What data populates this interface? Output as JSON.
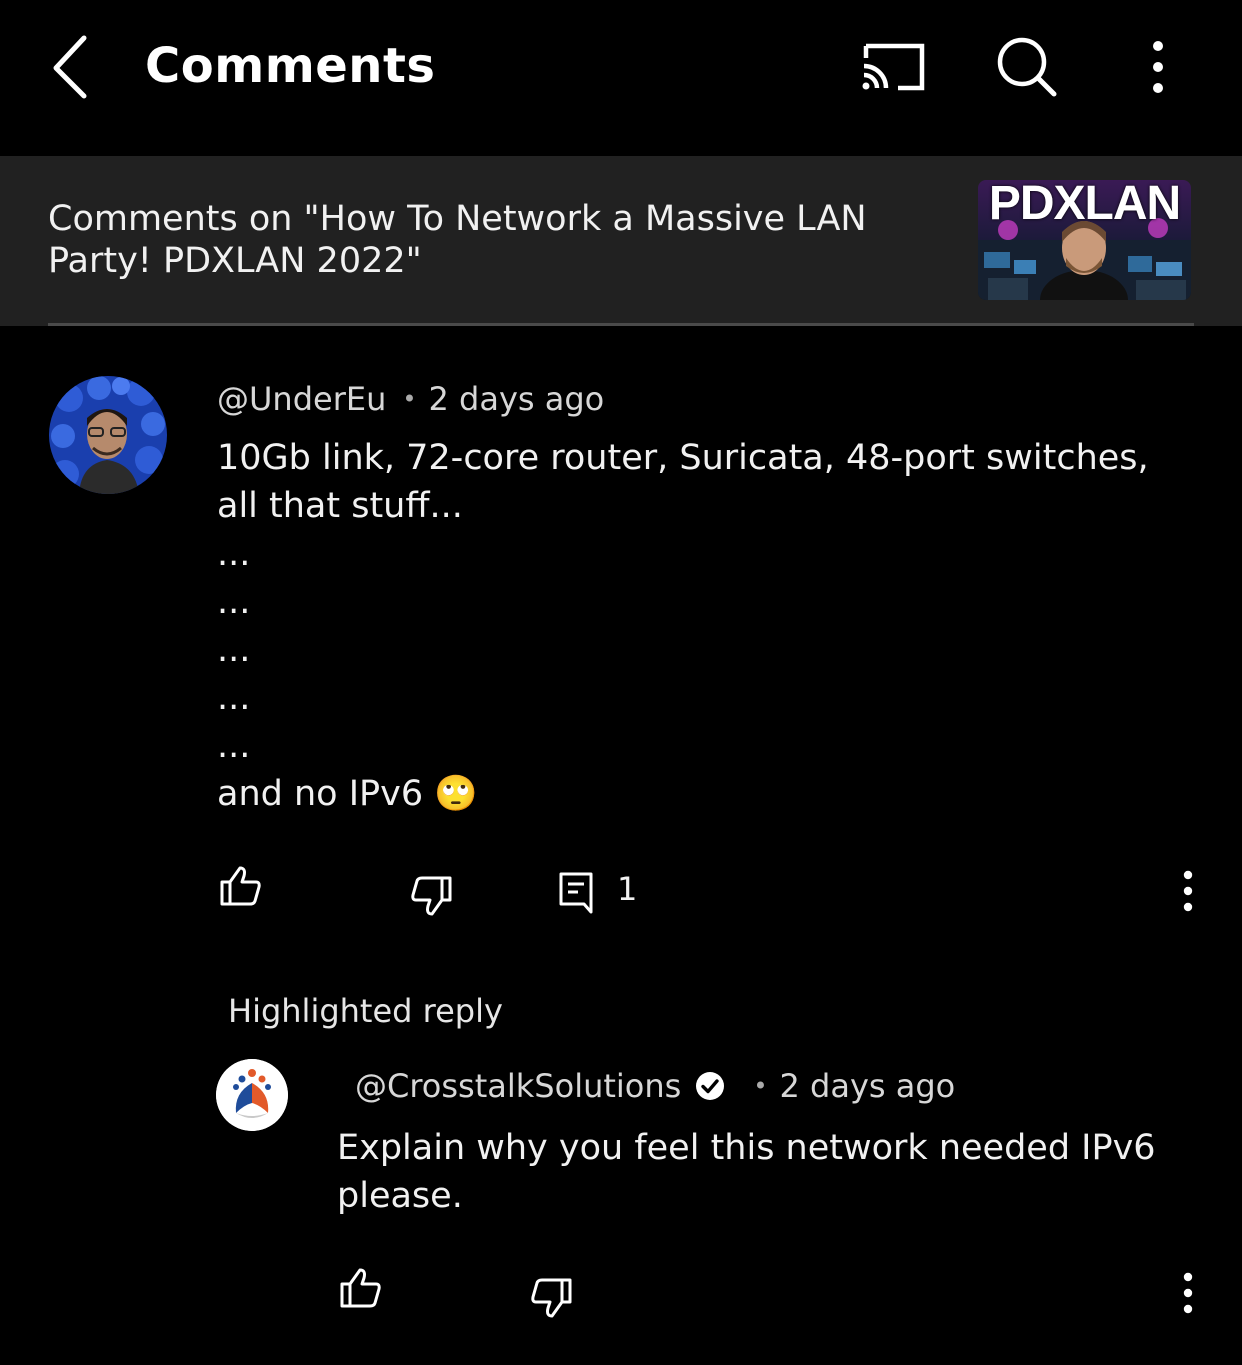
{
  "header": {
    "title": "Comments",
    "icons": [
      "back-arrow-icon",
      "cast-icon",
      "search-icon",
      "more-vertical-icon"
    ]
  },
  "video": {
    "title": "Comments on \"How To Network a Massive LAN Party! PDXLAN 2022\"",
    "thumbnail_text": "PDXLAN"
  },
  "comment": {
    "handle": "@UnderEu",
    "time": "2 days ago",
    "lines": [
      "10Gb link, 72-core router, Suricata, 48-port switches, all that stuff...",
      "...",
      "...",
      "...",
      "...",
      "...",
      "and no IPv6 🙄"
    ],
    "reply_count": "1"
  },
  "highlighted_label": "Highlighted reply",
  "reply": {
    "handle": "@CrosstalkSolutions",
    "time": "2 days ago",
    "text": "Explain why you feel this network needed IPv6 please."
  },
  "colors": {
    "background": "#000000",
    "header_band": "#212121",
    "text": "#f1f1f1"
  }
}
